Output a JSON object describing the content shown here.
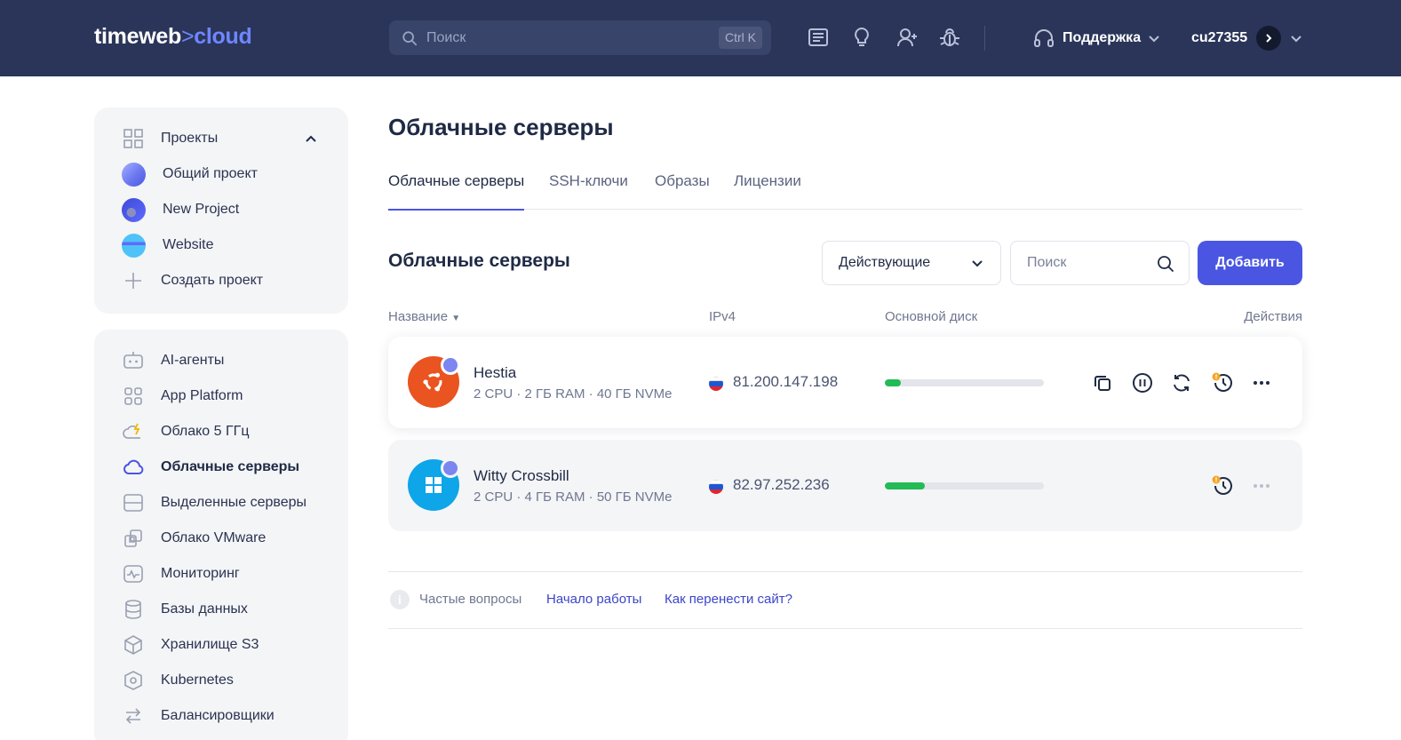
{
  "header": {
    "logo_main": "timeweb",
    "logo_sep": ">",
    "logo_accent": "cloud",
    "search_placeholder": "Поиск",
    "search_shortcut": "Ctrl K",
    "support_label": "Поддержка",
    "username": "cu27355"
  },
  "sidebar": {
    "projects_header": "Проекты",
    "projects": [
      {
        "label": "Общий проект",
        "color": "#7b86f0"
      },
      {
        "label": "New Project",
        "color": "#4a56e2"
      },
      {
        "label": "Website",
        "color": "#4fc3f7"
      }
    ],
    "create_project": "Создать проект",
    "items": [
      {
        "label": "AI-агенты",
        "icon": "robot-icon"
      },
      {
        "label": "App Platform",
        "icon": "apps-icon"
      },
      {
        "label": "Облако 5 ГГц",
        "icon": "cloud-bolt-icon"
      },
      {
        "label": "Облачные серверы",
        "icon": "cloud-icon"
      },
      {
        "label": "Выделенные серверы",
        "icon": "server-icon"
      },
      {
        "label": "Облако VMware",
        "icon": "vmware-icon"
      },
      {
        "label": "Мониторинг",
        "icon": "monitor-icon"
      },
      {
        "label": "Базы данных",
        "icon": "database-icon"
      },
      {
        "label": "Хранилище S3",
        "icon": "box-icon"
      },
      {
        "label": "Kubernetes",
        "icon": "kubernetes-icon"
      },
      {
        "label": "Балансировщики",
        "icon": "balancer-icon"
      }
    ]
  },
  "main": {
    "page_title": "Облачные серверы",
    "tabs": [
      "Облачные серверы",
      "SSH-ключи",
      "Образы",
      "Лицензии"
    ],
    "section_title": "Облачные серверы",
    "filter_value": "Действующие",
    "search_placeholder": "Поиск",
    "add_button": "Добавить",
    "columns": {
      "name": "Название",
      "ip": "IPv4",
      "disk": "Основной диск",
      "actions": "Действия"
    },
    "servers": [
      {
        "name": "Hestia",
        "spec": "2 CPU · 2 ГБ RAM · 40 ГБ NVMe",
        "ip": "81.200.147.198",
        "os": "ubuntu",
        "disk_usage": 0.1
      },
      {
        "name": "Witty Crossbill",
        "spec": "2 CPU · 4 ГБ RAM · 50 ГБ NVMe",
        "ip": "82.97.252.236",
        "os": "windows",
        "disk_usage": 0.25
      }
    ]
  },
  "faq": {
    "label": "Частые вопросы",
    "links": [
      "Начало работы",
      "Как перенести сайт?"
    ]
  },
  "colors": {
    "header_bg": "#2a3559",
    "accent": "#4a56e2",
    "ubuntu": "#e95420",
    "windows": "#0ea5e9",
    "disk_fill": "#22bb55"
  }
}
